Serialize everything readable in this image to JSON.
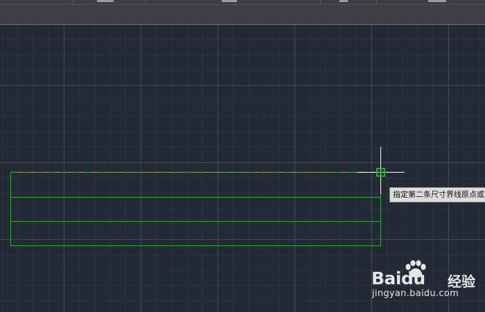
{
  "command_prompt": {
    "tooltip_text": "指定第二条尺寸界线原点或"
  },
  "colors": {
    "canvas_background": "#242a35",
    "geometry_green": "#00cc00",
    "extension_line_orange": "#d4a017",
    "snap_marker_green": "#1f9e1f",
    "crosshair": "#ffffff"
  },
  "icons": {
    "crosshair": "crosshair-cursor-icon",
    "snap_marker": "endpoint-snap-icon"
  },
  "watermark": {
    "brand": "Baidu",
    "product": "经验",
    "url": "jingyan.baidu.com"
  }
}
